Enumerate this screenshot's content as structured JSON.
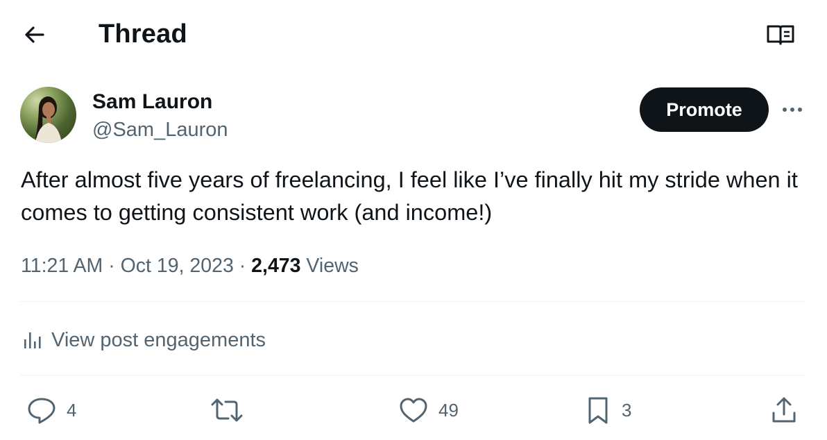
{
  "header": {
    "title": "Thread",
    "back_icon": "arrow-left-icon",
    "reader_icon": "book-open-icon"
  },
  "author": {
    "name": "Sam Lauron",
    "handle": "@Sam_Lauron",
    "promote_label": "Promote",
    "more_icon": "ellipsis-icon"
  },
  "post": {
    "text": "After almost five years of freelancing, I feel like I’ve finally hit my stride when it comes to getting consistent work (and income!)",
    "time": "11:21 AM",
    "date": "Oct 19, 2023",
    "separator": " · ",
    "views_count": "2,473",
    "views_label": "Views"
  },
  "engagements": {
    "label": "View post engagements",
    "icon": "bar-chart-icon"
  },
  "actions": {
    "replies": "4",
    "reposts": "",
    "likes": "49",
    "bookmarks": "3"
  },
  "colors": {
    "text_primary": "#0f1419",
    "text_secondary": "#536471",
    "divider": "#eff3f4",
    "promote_bg": "#0f1419"
  }
}
